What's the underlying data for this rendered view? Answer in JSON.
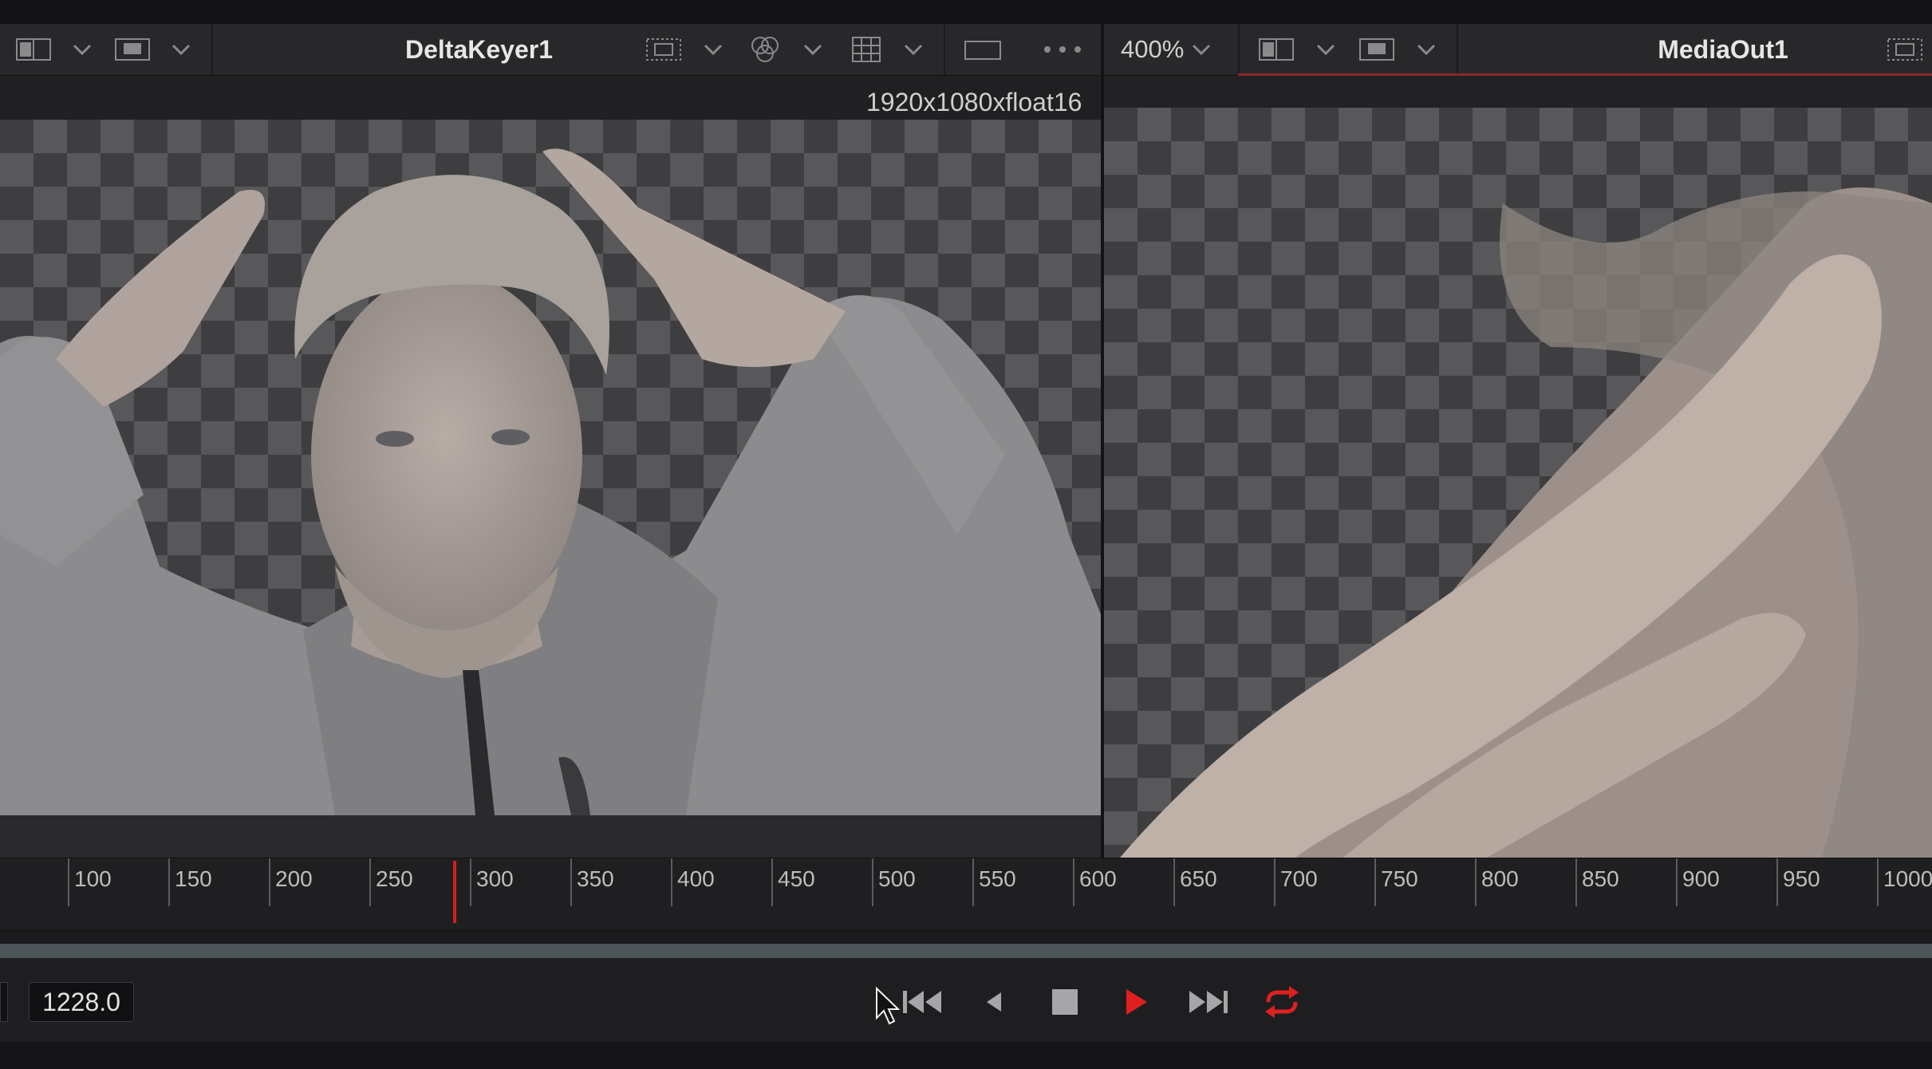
{
  "left_viewer": {
    "title": "DeltaKeyer1",
    "resolution": "1920x1080xfloat16"
  },
  "right_viewer": {
    "zoom": "400%",
    "title": "MediaOut1"
  },
  "timeline": {
    "ticks": [
      "100",
      "150",
      "200",
      "250",
      "300",
      "350",
      "400",
      "450",
      "500",
      "550",
      "600",
      "650",
      "700",
      "750",
      "800",
      "850",
      "900",
      "950",
      "1000"
    ]
  },
  "transport": {
    "current_frame": "1228.0"
  },
  "colors": {
    "accent_red": "#e02020",
    "background": "#1b1b1d"
  },
  "icons": {
    "play": "play-icon",
    "stop": "stop-icon",
    "loop": "loop-icon",
    "go_to_start": "go-to-start-icon",
    "go_to_end": "go-to-end-icon",
    "step_back": "step-back-icon",
    "cursor": "mouse-cursor-icon"
  }
}
